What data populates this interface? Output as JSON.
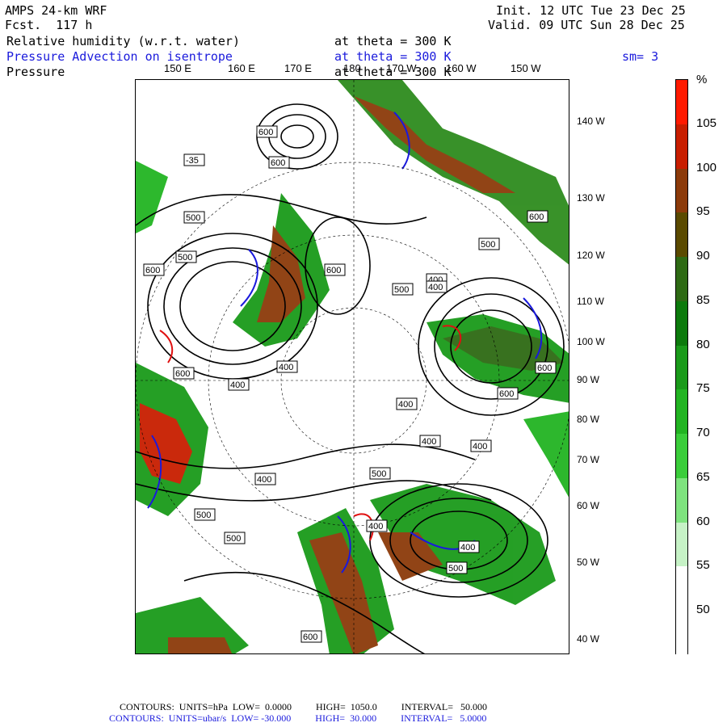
{
  "header": {
    "model": "AMPS 24-km WRF",
    "forecast": "Fcst.  117 h",
    "init": "Init. 12 UTC Tue 23 Dec 25",
    "valid": "Valid. 09 UTC Sun 28 Dec 25",
    "field1": "Relative humidity (w.r.t. water)",
    "field1_level": "at theta = 300 K",
    "field2": "Pressure Advection on isentrope",
    "field2_level": "at theta = 300 K",
    "smoothing": "sm= 3",
    "field3": "Pressure",
    "field3_level": "at theta = 300 K"
  },
  "lon_labels": [
    "150 E",
    "160 E",
    "170 E",
    "180",
    "170 W",
    "160 W",
    "150 W"
  ],
  "lat_labels": [
    "140 W",
    "130 W",
    "120 W",
    "110 W",
    "100 W",
    "90 W",
    "80 W",
    "70 W",
    "60 W",
    "50 W",
    "40 W"
  ],
  "colorbar": {
    "unit": "%",
    "labels": [
      "105",
      "100",
      "95",
      "90",
      "85",
      "80",
      "75",
      "70",
      "65",
      "60",
      "55",
      "50"
    ],
    "colors": [
      "#ff1a00",
      "#c81e00",
      "#8c3a0a",
      "#5a4a00",
      "#2e6a14",
      "#0c7a0c",
      "#1a9a1a",
      "#22b422",
      "#3acd3a",
      "#7ee37e",
      "#c6f2c6",
      "#ffffff",
      "#ffffff"
    ]
  },
  "contour_labels": [
    "600",
    "600",
    "-35",
    "500",
    "500",
    "600",
    "600",
    "500",
    "400",
    "400",
    "400",
    "600",
    "400",
    "600",
    "400",
    "500",
    "400",
    "500",
    "600",
    "400",
    "400",
    "500",
    "400",
    "400",
    "500",
    "600",
    "500",
    "600"
  ],
  "footer": {
    "line1": "CONTOURS:  UNITS=hPa  LOW=  0.0000          HIGH=  1050.0          INTERVAL=   50.000",
    "line2": "CONTOURS:  UNITS=ubar/s  LOW= -30.000          HIGH=  30.000          INTERVAL=   5.0000"
  }
}
